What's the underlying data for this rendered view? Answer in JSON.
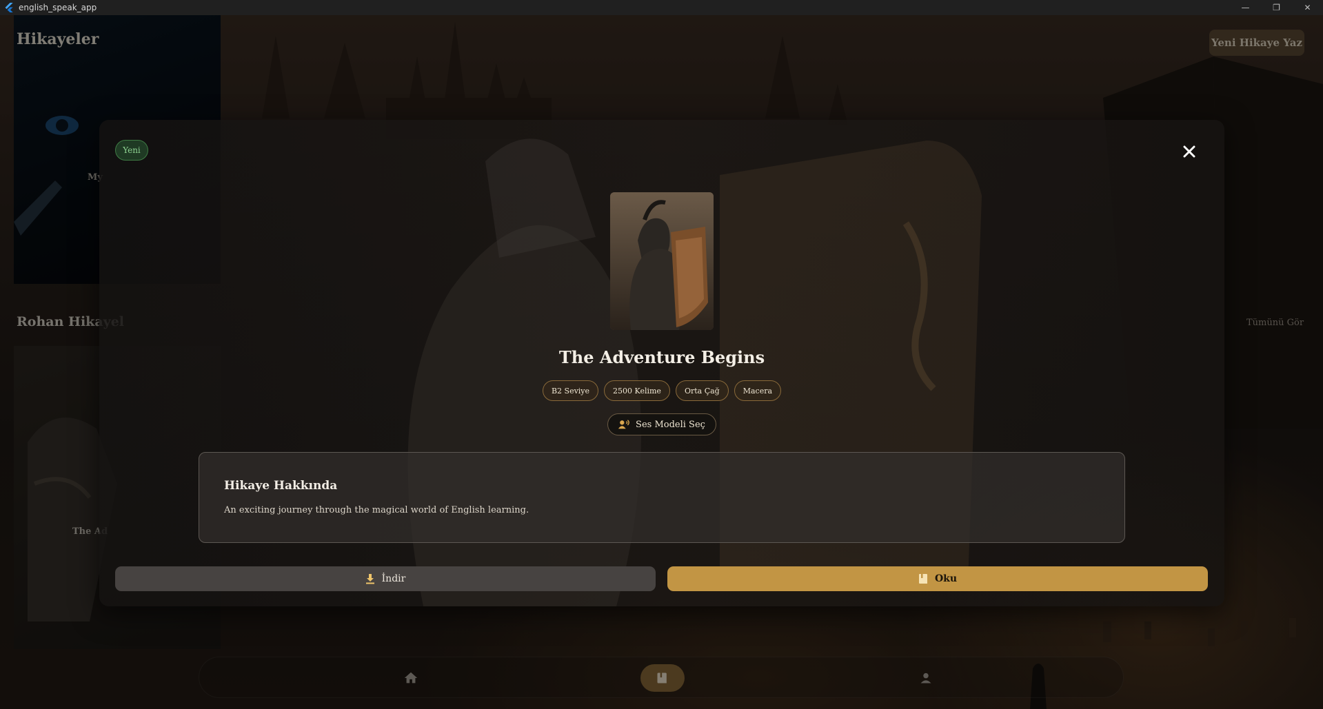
{
  "window": {
    "title": "english_speak_app",
    "minimize_glyph": "—",
    "restore_glyph": "❐",
    "close_glyph": "✕"
  },
  "background": {
    "page_title": "Hikayeler",
    "new_story_button": "Yeni Hikaye Yaz",
    "card_1_title": "My",
    "section_title": "Rohan Hikayel",
    "see_all_link": "Tümünü Gör",
    "card_2_title": "The Ad"
  },
  "bottom_nav": {
    "items": [
      {
        "icon": "home-icon",
        "active": false
      },
      {
        "icon": "book-icon",
        "active": true
      },
      {
        "icon": "person-icon",
        "active": false
      }
    ]
  },
  "modal": {
    "badge": "Yeni",
    "title": "The Adventure Begins",
    "tags": [
      "B2 Seviye",
      "2500 Kelime",
      "Orta Çağ",
      "Macera"
    ],
    "voice_button": "Ses Modeli Seç",
    "about": {
      "heading": "Hikaye Hakkında",
      "text": "An exciting journey through the magical world of English learning."
    },
    "download_button": "İndir",
    "read_button": "Oku"
  },
  "colors": {
    "accent_gold": "#c29544",
    "badge_green": "#8fd392",
    "nav_active": "#8a6a3a"
  }
}
